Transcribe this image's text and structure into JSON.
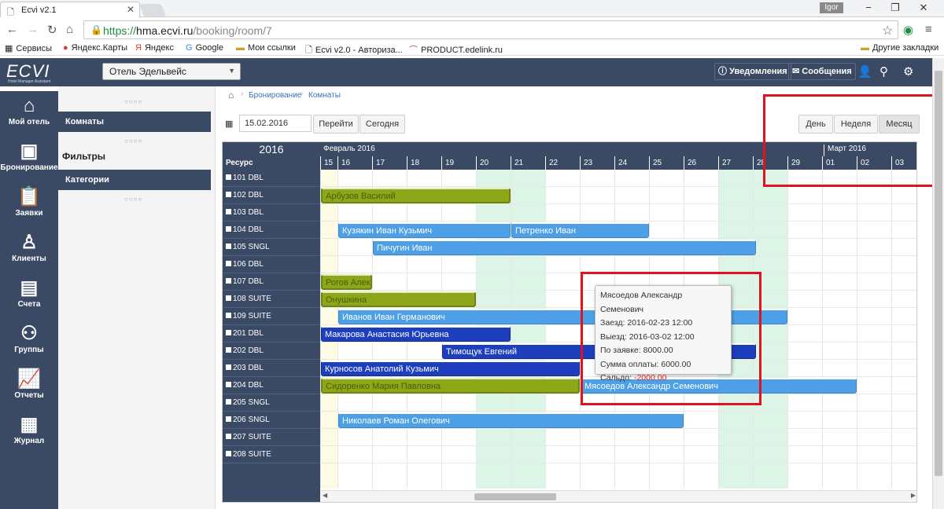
{
  "browser": {
    "tab_title": "Ecvi v2.1",
    "user_badge": "Igor",
    "url_scheme": "https://",
    "url_host": "hma.ecvi.ru",
    "url_path": "/booking/room/7",
    "bookmarks": [
      "Сервисы",
      "Яндекс.Карты",
      "Яндекс",
      "Google",
      "Мои ссылки",
      "Ecvi v2.0 - Авториза...",
      "PRODUCT.edelink.ru"
    ],
    "other_bookmarks": "Другие закладки"
  },
  "header": {
    "logo": "ECVI",
    "logo_sub": "Hotel Manager Assistant",
    "hotel": "Отель Эдельвейс",
    "notifications": "Уведомления",
    "messages": "Сообщения"
  },
  "nav": [
    {
      "label": "Мой отель",
      "icon": "home-icon"
    },
    {
      "label": "Бронирование",
      "icon": "archive-icon"
    },
    {
      "label": "Заявки",
      "icon": "clipboard-icon"
    },
    {
      "label": "Клиенты",
      "icon": "user-icon"
    },
    {
      "label": "Счета",
      "icon": "invoice-icon"
    },
    {
      "label": "Группы",
      "icon": "group-icon"
    },
    {
      "label": "Отчеты",
      "icon": "chart-icon"
    },
    {
      "label": "Журнал",
      "icon": "journal-icon"
    }
  ],
  "subnav": {
    "rooms": "Комнаты",
    "filters": "Фильтры",
    "categories": "Категории"
  },
  "breadcrumb": [
    "Бронирование",
    "Комнаты"
  ],
  "toolbar": {
    "date": "15.02.2016",
    "go": "Перейти",
    "today": "Сегодня",
    "day": "День",
    "week": "Неделя",
    "month": "Месяц"
  },
  "calendar": {
    "year": "2016",
    "resource_header": "Ресурс",
    "month1": "Февраль 2016",
    "month2": "Март 2016",
    "days": [
      "15",
      "16",
      "17",
      "18",
      "19",
      "20",
      "21",
      "22",
      "23",
      "24",
      "25",
      "26",
      "27",
      "28",
      "29",
      "01",
      "02",
      "03"
    ],
    "rooms": [
      "101 DBL",
      "102 DBL",
      "103 DBL",
      "104 DBL",
      "105 SNGL",
      "106 DBL",
      "107 DBL",
      "108 SUITE",
      "109 SUITE",
      "201 DBL",
      "202 DBL",
      "203 DBL",
      "204 DBL",
      "205 SNGL",
      "206 SNGL",
      "207 SUITE",
      "208 SUITE"
    ],
    "bookings": [
      {
        "row": 1,
        "start": 0,
        "end": 6,
        "name": "Арбузов Василий",
        "style": "green"
      },
      {
        "row": 3,
        "start": 1,
        "end": 6,
        "name": "Кузякин Иван Кузьмич",
        "style": "light"
      },
      {
        "row": 3,
        "start": 6,
        "end": 10,
        "name": "Петренко Иван",
        "style": "light"
      },
      {
        "row": 4,
        "start": 2,
        "end": 13.1,
        "name": "Пичугин Иван",
        "style": "light"
      },
      {
        "row": 6,
        "start": 0,
        "end": 2,
        "name": "Рогов Алексей",
        "style": "green"
      },
      {
        "row": 7,
        "start": 0,
        "end": 5,
        "name": "Онушкина",
        "style": "green"
      },
      {
        "row": 8,
        "start": 1,
        "end": 14,
        "name": "Иванов Иван Германович",
        "style": "light"
      },
      {
        "row": 9,
        "start": 0,
        "end": 6,
        "name": "Макарова Анастасия Юрьевна",
        "style": "dark"
      },
      {
        "row": 10,
        "start": 4,
        "end": 13.1,
        "name": "Тимощук Евгений",
        "style": "dark"
      },
      {
        "row": 11,
        "start": 0,
        "end": 8,
        "name": "Курносов Анатолий Кузьмич",
        "style": "dark"
      },
      {
        "row": 12,
        "start": 0,
        "end": 8,
        "name": "Сидоренко Мария Павловна",
        "style": "green"
      },
      {
        "row": 12,
        "start": 8,
        "end": 16,
        "name": "Мясоедов Александр Семенович",
        "style": "light"
      },
      {
        "row": 14,
        "start": 1,
        "end": 11,
        "name": "Николаев Роман Олегович",
        "style": "light"
      }
    ]
  },
  "tooltip": {
    "name": "Мясоедов Александр Семенович",
    "checkin": "Заезд: 2016-02-23 12:00",
    "checkout": "Выезд: 2016-03-02 12:00",
    "order_sum": "По заявке: 8000.00",
    "paid": "Сумма оплаты: 6000.00",
    "balance_label": "Сальдо: ",
    "balance_value": "-2000.00"
  },
  "colors": {
    "header_bg": "#3b4a64",
    "booking_green": "#8da718",
    "booking_light": "#4da0e6",
    "booking_dark": "#1d3fbe",
    "weekend": "#dcf5e6",
    "today": "#fdfbe4",
    "highlight_red": "#e0141e"
  }
}
